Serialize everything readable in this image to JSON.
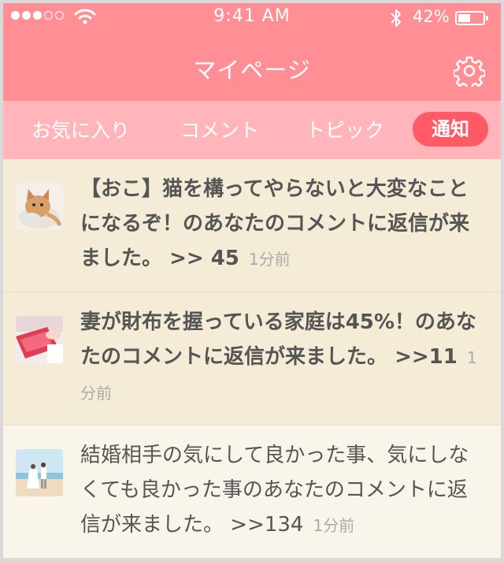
{
  "status_bar": {
    "time": "9:41 AM",
    "battery": "42%",
    "battery_level": 0.42
  },
  "nav": {
    "title": "マイページ",
    "settings_icon": "gear-icon"
  },
  "tabs": [
    {
      "label": "お気に入り",
      "active": false
    },
    {
      "label": "コメント",
      "active": false
    },
    {
      "label": "トピック",
      "active": false
    },
    {
      "label": "通知",
      "active": true
    }
  ],
  "notifications": [
    {
      "text": "【おこ】猫を構ってやらないと大変なことになるぞ！のあなたのコメントに返信が来ました。",
      "count": ">> 45",
      "time": "1分前",
      "unread": true,
      "thumb": "cat-photo"
    },
    {
      "text": "妻が財布を握っている家庭は45%！のあなたのコメントに返信が来ました。",
      "count": ">>11",
      "time": "1分前",
      "unread": true,
      "thumb": "wallet-photo"
    },
    {
      "text": "結婚相手の気にして良かった事、気にしなくても良かった事のあなたのコメントに返信が来ました。",
      "count": ">>134",
      "time": "1分前",
      "unread": false,
      "thumb": "wedding-beach-photo"
    }
  ],
  "colors": {
    "nav_bg": "#ff8f95",
    "tab_bg": "#ffb5b9",
    "active_tab": "#ff5a66",
    "unread_bg": "#f5ecd8",
    "read_bg": "#f9f5ea"
  }
}
